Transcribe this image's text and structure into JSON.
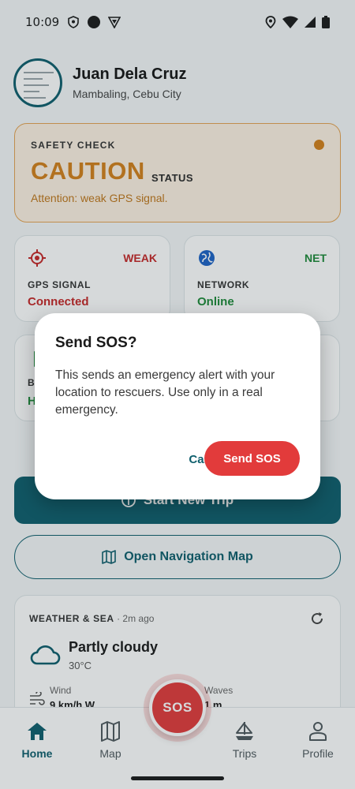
{
  "status_bar": {
    "time": "10:09"
  },
  "profile": {
    "name": "Juan Dela Cruz",
    "location": "Mambaling, Cebu City"
  },
  "safety_check": {
    "title": "SAFETY CHECK",
    "level": "CAUTION",
    "level_suffix": "STATUS",
    "message": "Attention: weak GPS signal.",
    "color": "#d3801c"
  },
  "stats": {
    "gps": {
      "badge": "WEAK",
      "label": "GPS SIGNAL",
      "value": "Connected",
      "color": "#c62828"
    },
    "network": {
      "badge": "NET",
      "label": "NETWORK",
      "value": "Online",
      "color": "#1f8a3a"
    },
    "battery_partial": {
      "label": "BA",
      "value": "H",
      "color": "#1f8a3a"
    }
  },
  "actions": {
    "start_trip": "Start New Trip",
    "open_map": "Open Navigation Map"
  },
  "weather": {
    "header": "WEATHER & SEA",
    "updated": "· 2m ago",
    "condition": "Partly cloudy",
    "temperature": "30°C",
    "wind_label": "Wind",
    "wind_value": "9 km/h W",
    "waves_label": "Waves",
    "waves_value": "1 m"
  },
  "bottom_nav": {
    "home": "Home",
    "map": "Map",
    "sos": "SOS",
    "trips": "Trips",
    "profile": "Profile"
  },
  "dialog": {
    "title": "Send SOS?",
    "body": "This sends an emergency alert with your location to rescuers. Use only in a real emergency.",
    "cancel": "Cancel",
    "confirm": "Send SOS"
  },
  "colors": {
    "primary": "#0f5f6d",
    "danger": "#e23b3b",
    "warning": "#d3801c"
  }
}
